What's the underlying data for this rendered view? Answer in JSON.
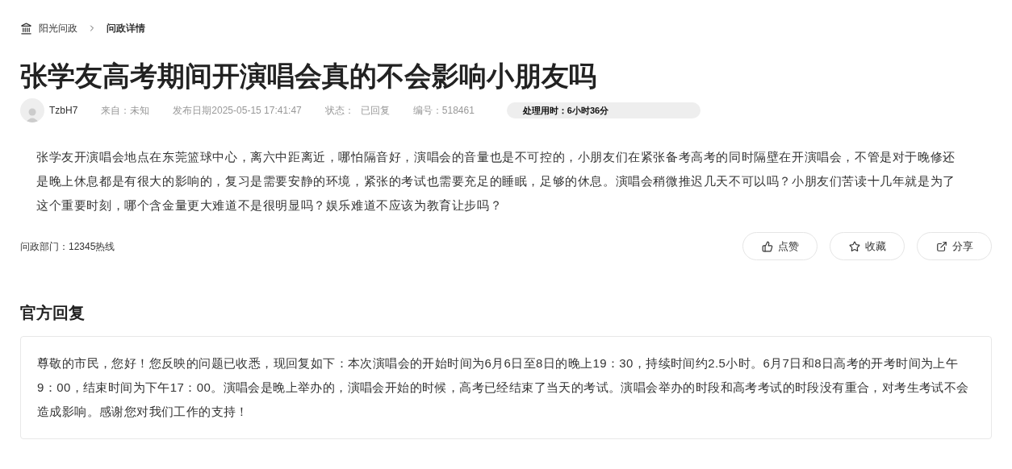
{
  "breadcrumb": [
    {
      "label": "阳光问政"
    },
    {
      "label": "问政详情"
    }
  ],
  "title": "张学友高考期间开演唱会真的不会影响小朋友吗",
  "meta": {
    "author": "TzbH7",
    "source": "来自：未知",
    "date": "发布日期2025-05-15 17:41:47",
    "status_label": "状态：",
    "status": "已回复",
    "number": "编号：518461",
    "duration": "处理用时：6小时36分"
  },
  "content": "张学友开演唱会地点在东莞篮球中心，离六中距离近，哪怕隔音好，演唱会的音量也是不可控的，小朋友们在紧张备考高考的同时隔壁在开演唱会，不管是对于晚修还是晚上休息都是有很大的影响的，复习是需要安静的环境，紧张的考试也需要充足的睡眠，足够的休息。演唱会稍微推迟几天不可以吗？小朋友们苦读十几年就是为了这个重要时刻，哪个含金量更大难道不是很明显吗？娱乐难道不应该为教育让步吗？",
  "department": "问政部门：12345热线",
  "actions": [
    {
      "kind": "like",
      "label": "点赞"
    },
    {
      "kind": "favorite",
      "label": "收藏"
    },
    {
      "kind": "share",
      "label": "分享"
    }
  ],
  "reply": {
    "heading": "官方回复",
    "text": "尊敬的市民，您好！您反映的问题已收悉，现回复如下：本次演唱会的开始时间为6月6日至8日的晚上19：30，持续时间约2.5小时。6月7日和8日高考的开考时间为上午9：00，结束时间为下午17：00。演唱会是晚上举办的，演唱会开始的时候，高考已经结束了当天的考试。演唱会举办的时段和高考考试的时段没有重合，对考生考试不会造成影响。感谢您对我们工作的支持！"
  }
}
